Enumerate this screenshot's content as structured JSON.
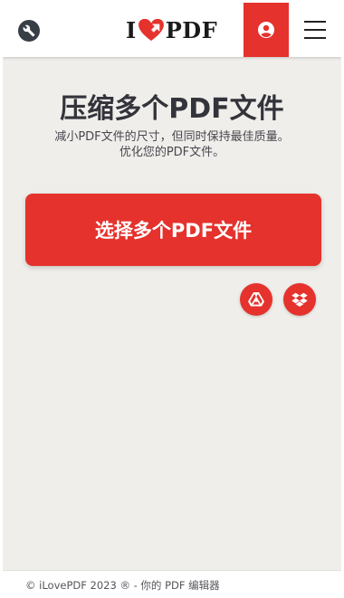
{
  "header": {
    "logo_left": "I",
    "logo_right": "PDF",
    "icons": {
      "tools": "wrench-icon",
      "logo": "heart-icon",
      "account": "user-icon",
      "menu": "hamburger-menu-icon"
    }
  },
  "main": {
    "title": "压缩多个PDF文件",
    "subtitle_line1": "减小PDF文件的尺寸，但同时保持最佳质量。",
    "subtitle_line2": "优化您的PDF文件。",
    "select_button_label": "选择多个PDF文件",
    "cloud_icons": [
      "google-drive-icon",
      "dropbox-icon"
    ]
  },
  "footer": {
    "text": "© iLovePDF 2023 ® - 你的 PDF 编辑器"
  },
  "colors": {
    "brand_red": "#e5322d",
    "background": "#f0eeea",
    "text_dark": "#33333b"
  }
}
